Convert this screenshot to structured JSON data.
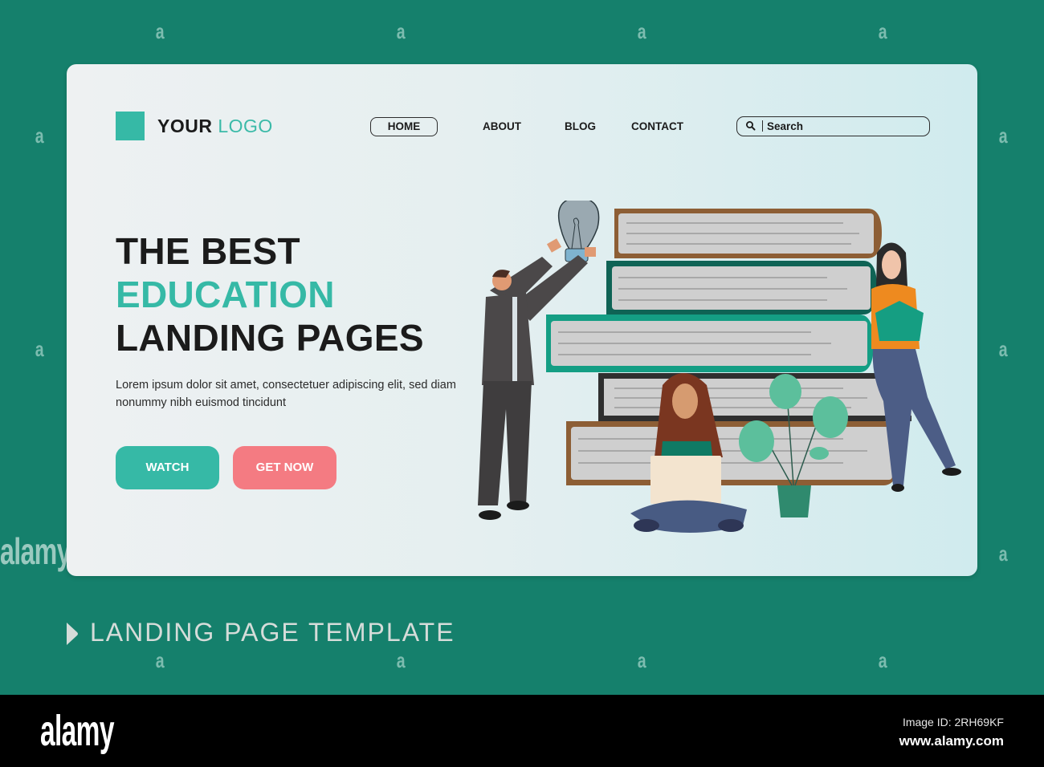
{
  "header": {
    "logo": {
      "primary": "YOUR",
      "secondary": "LOGO"
    },
    "nav": [
      {
        "label": "HOME",
        "active": true
      },
      {
        "label": "ABOUT",
        "active": false
      },
      {
        "label": "BLOG",
        "active": false
      },
      {
        "label": "CONTACT",
        "active": false
      }
    ],
    "search": {
      "placeholder": "Search",
      "value": "",
      "icon": "search-icon"
    }
  },
  "hero": {
    "headline_line1": "THE BEST",
    "headline_line2": "EDUCATION",
    "headline_line3": "LANDING PAGES",
    "description": "Lorem ipsum dolor sit amet, consectetuer adipiscing elit, sed diam nonummy nibh euismod tincidunt",
    "buttons": [
      {
        "label": "WATCH"
      },
      {
        "label": "GET NOW"
      }
    ],
    "illustration": "Stack of books with a man holding a light bulb, a woman with laptop, a plant, and a woman reading"
  },
  "caption": {
    "icon": "chevron-right-icon",
    "text": "LANDING PAGE TEMPLATE"
  },
  "footer": {
    "brand": "alamy",
    "image_id": "Image ID: 2RH69KF",
    "url": "www.alamy.com"
  },
  "watermark": {
    "glyph": "a",
    "word": "alamy"
  },
  "colors": {
    "background": "#15806c",
    "accent_teal": "#36b9a6",
    "accent_pink": "#f47b82",
    "text_dark": "#1b1b1b",
    "caption_text": "#d5dcd9"
  }
}
